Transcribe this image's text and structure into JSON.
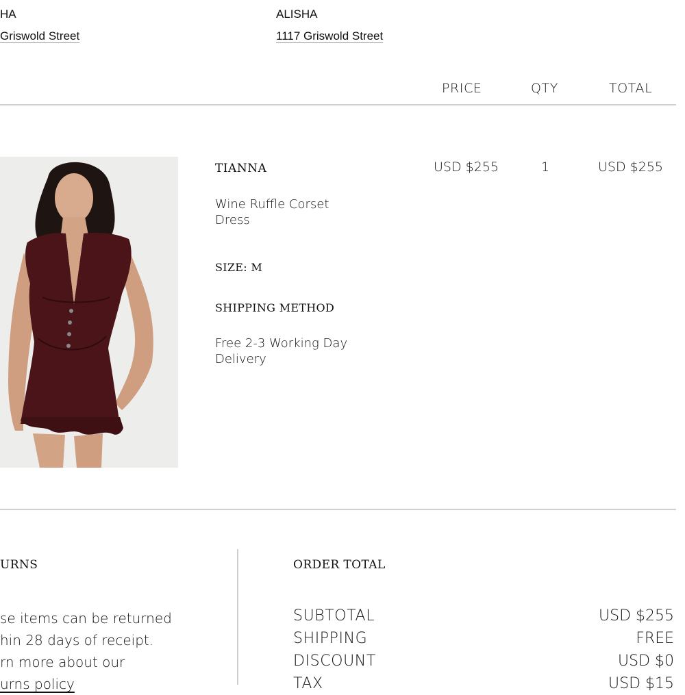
{
  "addresses": {
    "billing": {
      "name": "HA",
      "street": " Griswold Street"
    },
    "shipping": {
      "name": "ALISHA",
      "street": "1117 Griswold Street"
    }
  },
  "table": {
    "headers": {
      "price": "PRICE",
      "qty": "QTY",
      "total": "TOTAL"
    }
  },
  "item": {
    "image": "product-photo",
    "brand": "TIANNA",
    "name_line1": "Wine Ruffle Corset",
    "name_line2": "Dress",
    "size": "SIZE: M",
    "shipping_method_label": "SHIPPING METHOD",
    "shipping_method_line1": "Free 2-3 Working Day",
    "shipping_method_line2": "Delivery",
    "price": "USD $255",
    "qty": "1",
    "total": "USD $255"
  },
  "returns": {
    "heading": "URNS",
    "lines": [
      "se items can be returned",
      "hin 28 days of receipt.",
      "rn more about our",
      "urns policy"
    ]
  },
  "order_total": {
    "heading": "ORDER TOTAL",
    "rows": [
      {
        "label": "SUBTOTAL",
        "value": "USD $255"
      },
      {
        "label": "SHIPPING",
        "value": "FREE"
      },
      {
        "label": "DISCOUNT",
        "value": "USD $0"
      },
      {
        "label": "TAX",
        "value": "USD $15"
      }
    ]
  },
  "colors": {
    "dress": "#4a1418",
    "photo_bg": "#ededeb",
    "rule": "#cfcfcf"
  }
}
